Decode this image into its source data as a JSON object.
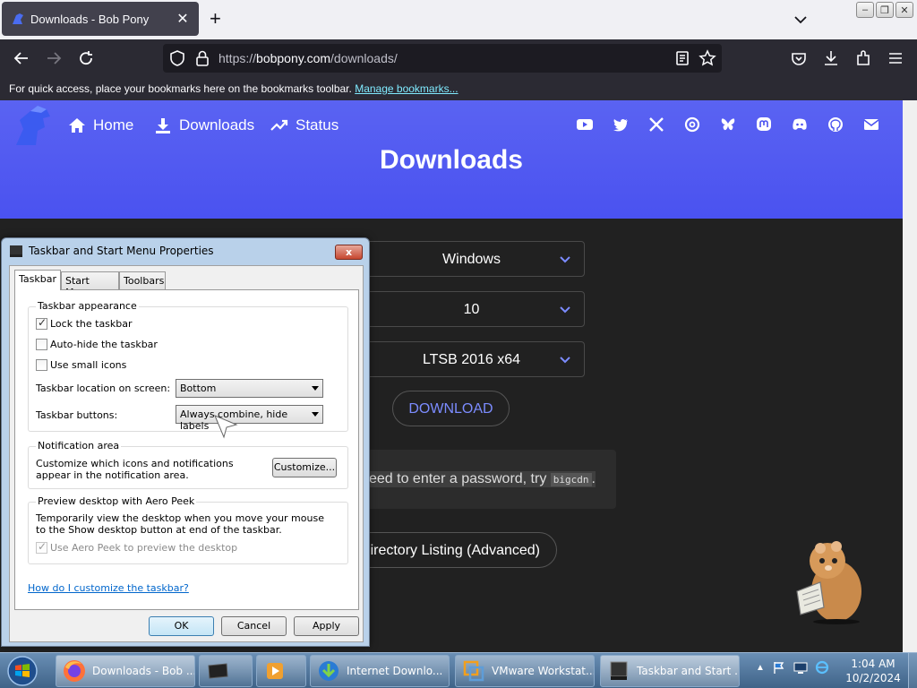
{
  "browser": {
    "tab_title": "Downloads - Bob Pony",
    "url_prefix": "https://",
    "url_host": "bobpony.com",
    "url_path": "/downloads/",
    "bookmarks_hint": "For quick access, place your bookmarks here on the bookmarks toolbar.",
    "manage_bookmarks": "Manage bookmarks..."
  },
  "site": {
    "nav": {
      "home": "Home",
      "downloads": "Downloads",
      "status": "Status"
    },
    "hero_title": "Downloads",
    "selects": [
      "Windows",
      "10",
      "LTSB 2016 x64"
    ],
    "download_label": "DOWNLOAD",
    "password_text": "eed to enter a password, try",
    "password_code": "bigcdn",
    "password_end": ".",
    "directory_label": "irectory Listing (Advanced)",
    "accent": "#4a52f0"
  },
  "dialog": {
    "title": "Taskbar and Start Menu Properties",
    "close_label": "x",
    "tabs": [
      "Taskbar",
      "Start Menu",
      "Toolbars"
    ],
    "appearance": {
      "title": "Taskbar appearance",
      "lock": "Lock the taskbar",
      "autohide": "Auto-hide the taskbar",
      "small_icons": "Use small icons",
      "location_label": "Taskbar location on screen:",
      "location_value": "Bottom",
      "buttons_label": "Taskbar buttons:",
      "buttons_value": "Always combine, hide labels"
    },
    "notification": {
      "title": "Notification area",
      "text": "Customize which icons and notifications appear in the notification area.",
      "customize": "Customize..."
    },
    "peek": {
      "title": "Preview desktop with Aero Peek",
      "text": "Temporarily view the desktop when you move your mouse to the Show desktop button at end of the taskbar.",
      "checkbox": "Use Aero Peek to preview the desktop"
    },
    "help_link": "How do I customize the taskbar?",
    "ok": "OK",
    "cancel": "Cancel",
    "apply": "Apply"
  },
  "taskbar": {
    "items": [
      "Downloads - Bob ...",
      "Internet Downlo...",
      "VMware Workstat...",
      "Taskbar and Start ..."
    ],
    "time": "1:04 AM",
    "date": "10/2/2024"
  }
}
